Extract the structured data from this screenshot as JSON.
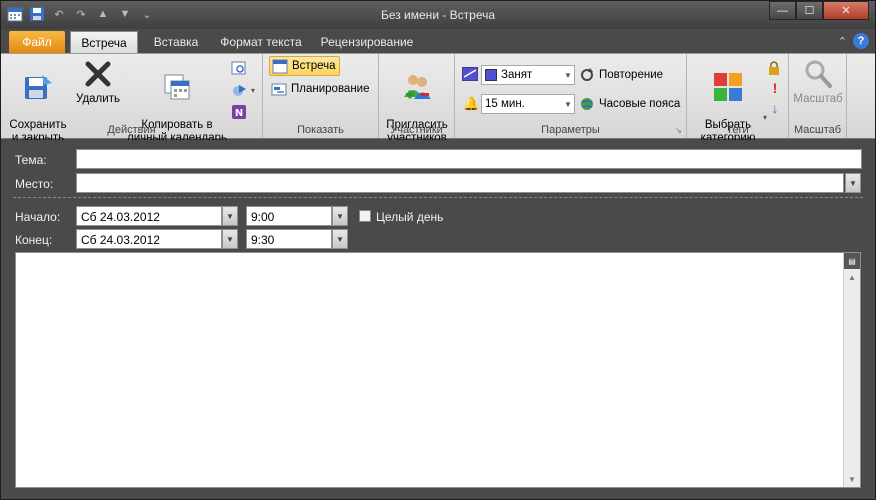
{
  "window": {
    "title": "Без имени  -  Встреча"
  },
  "tabs": [
    {
      "label": "Файл"
    },
    {
      "label": "Встреча"
    },
    {
      "label": "Вставка"
    },
    {
      "label": "Формат текста"
    },
    {
      "label": "Рецензирование"
    }
  ],
  "ribbon": {
    "actions": {
      "label": "Действия",
      "save_close": "Сохранить\nи закрыть",
      "delete": "Удалить",
      "copy_calendar": "Копировать в\nличный календарь"
    },
    "show": {
      "label": "Показать",
      "appointment": "Встреча",
      "scheduling": "Планирование"
    },
    "attendees": {
      "label": "Участники",
      "invite": "Пригласить\nучастников"
    },
    "options": {
      "label": "Параметры",
      "show_as": "Занят",
      "reminder": "15 мин.",
      "recurrence": "Повторение",
      "time_zones": "Часовые пояса"
    },
    "tags": {
      "label": "Теги",
      "categorize": "Выбрать\nкатегорию"
    },
    "zoom": {
      "label": "Масштаб",
      "button": "Масштаб"
    }
  },
  "form": {
    "subject_label": "Тема:",
    "subject_value": "",
    "location_label": "Место:",
    "location_value": "",
    "start_label": "Начало:",
    "start_date": "Сб 24.03.2012",
    "start_time": "9:00",
    "all_day_label": "Целый день",
    "end_label": "Конец:",
    "end_date": "Сб 24.03.2012",
    "end_time": "9:30"
  },
  "colors": {
    "accent_file_tab": "#e38a14",
    "show_as_busy": "#4f4fd0"
  }
}
